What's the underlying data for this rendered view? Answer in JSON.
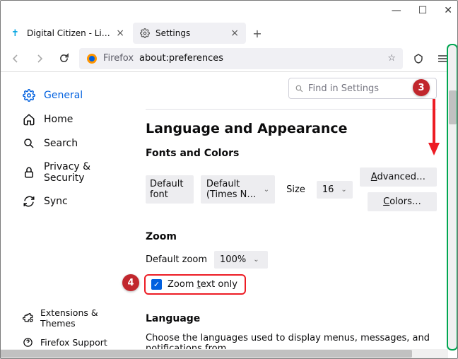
{
  "window": {
    "minimize": "—",
    "maximize": "☐",
    "close": "✕"
  },
  "tabs": {
    "items": [
      {
        "title": "Digital Citizen - Life in a digital"
      },
      {
        "title": "Settings"
      }
    ],
    "newtab": "+"
  },
  "toolbar": {
    "prefix": "Firefox",
    "url": "about:preferences"
  },
  "search": {
    "placeholder": "Find in Settings"
  },
  "sidebar": {
    "items": [
      {
        "label": "General"
      },
      {
        "label": "Home"
      },
      {
        "label": "Search"
      },
      {
        "label": "Privacy & Security"
      },
      {
        "label": "Sync"
      }
    ],
    "bottom": [
      {
        "label": "Extensions & Themes"
      },
      {
        "label": "Firefox Support"
      }
    ]
  },
  "page": {
    "heading": "Language and Appearance",
    "fonts": {
      "title": "Fonts and Colors",
      "default_font_label": "Default font",
      "default_font_value": "Default (Times N…",
      "size_label": "Size",
      "size_value": "16",
      "advanced": "Advanced…",
      "colors": "Colors…"
    },
    "zoom": {
      "title": "Zoom",
      "default_label": "Default zoom",
      "default_value": "100%",
      "text_only_pre": "Zoom ",
      "text_only_key": "t",
      "text_only_post": "ext only"
    },
    "language": {
      "title": "Language",
      "desc": "Choose the languages used to display menus, messages, and notifications from"
    }
  },
  "annotations": {
    "step3": "3",
    "step4": "4"
  }
}
